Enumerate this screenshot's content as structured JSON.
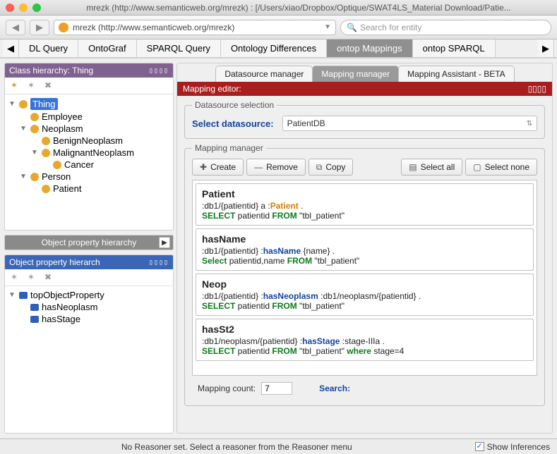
{
  "window": {
    "title": "mrezk (http://www.semanticweb.org/mrezk)  :  [/Users/xiao/Dropbox/Optique/SWAT4LS_Material Download/Patie..."
  },
  "urlbar": {
    "label": "mrezk (http://www.semanticweb.org/mrezk)"
  },
  "search": {
    "placeholder": "Search for entity"
  },
  "top_tabs": {
    "scroll_left": "◀",
    "scroll_right": "▶",
    "items": [
      "DL Query",
      "OntoGraf",
      "SPARQL Query",
      "Ontology Differences",
      "ontop Mappings",
      "ontop SPARQL"
    ],
    "active_index": 4
  },
  "class_panel": {
    "title": "Class hierarchy: Thing",
    "tree": [
      {
        "label": "Thing",
        "level": 0,
        "arrow": "▼",
        "selected": true
      },
      {
        "label": "Employee",
        "level": 1,
        "arrow": ""
      },
      {
        "label": "Neoplasm",
        "level": 1,
        "arrow": "▼"
      },
      {
        "label": "BenignNeoplasm",
        "level": 2,
        "arrow": ""
      },
      {
        "label": "MalignantNeoplasm",
        "level": 2,
        "arrow": "▼"
      },
      {
        "label": "Cancer",
        "level": 3,
        "arrow": ""
      },
      {
        "label": "Person",
        "level": 1,
        "arrow": "▼"
      },
      {
        "label": "Patient",
        "level": 2,
        "arrow": ""
      }
    ]
  },
  "obj_tab": {
    "label": "Object property hierarchy"
  },
  "obj_panel": {
    "title": "Object property hierarch",
    "tree": [
      {
        "label": "topObjectProperty",
        "level": 0,
        "arrow": "▼"
      },
      {
        "label": "hasNeoplasm",
        "level": 1,
        "arrow": ""
      },
      {
        "label": "hasStage",
        "level": 1,
        "arrow": ""
      }
    ]
  },
  "subtabs": {
    "items": [
      "Datasource manager",
      "Mapping manager",
      "Mapping Assistant - BETA"
    ],
    "active_index": 1
  },
  "editor_bar": "Mapping editor:",
  "datasource": {
    "legend": "Datasource selection",
    "label": "Select datasource:",
    "value": "PatientDB"
  },
  "mapping_mgr": {
    "legend": "Mapping manager",
    "buttons": {
      "create": "Create",
      "remove": "Remove",
      "copy": "Copy",
      "select_all": "Select all",
      "select_none": "Select none"
    }
  },
  "mappings": [
    {
      "name": "Patient",
      "target_pre": ":db1/{patientid} a :",
      "target_cls": "Patient",
      "target_post": " .",
      "sql": [
        [
          "SELECT",
          " patientid "
        ],
        [
          "FROM",
          " \"tbl_patient\""
        ]
      ]
    },
    {
      "name": "hasName",
      "target_pre": ":db1/{patientid} :",
      "target_prop": "hasName",
      "target_post": " {name} .",
      "sql": [
        [
          "Select",
          " patientid,name "
        ],
        [
          "FROM",
          " \"tbl_patient\""
        ]
      ]
    },
    {
      "name": "Neop",
      "target_pre": ":db1/{patientid} :",
      "target_prop": "hasNeoplasm",
      "target_post": " :db1/neoplasm/{patientid} .",
      "sql": [
        [
          "SELECT",
          " patientid "
        ],
        [
          "FROM",
          " \"tbl_patient\""
        ]
      ]
    },
    {
      "name": "hasSt2",
      "target_pre": ":db1/neoplasm/{patientid} :",
      "target_prop": "hasStage",
      "target_post": " :stage-IIIa .",
      "sql": [
        [
          "SELECT",
          " patientid "
        ],
        [
          "FROM",
          " \"tbl_patient\" "
        ],
        [
          "where",
          " stage=4"
        ]
      ]
    }
  ],
  "count": {
    "label": "Mapping count:",
    "value": "7",
    "search_label": "Search:"
  },
  "status": {
    "msg": "No Reasoner set. Select a reasoner from the Reasoner menu",
    "checkbox": "Show Inferences"
  }
}
